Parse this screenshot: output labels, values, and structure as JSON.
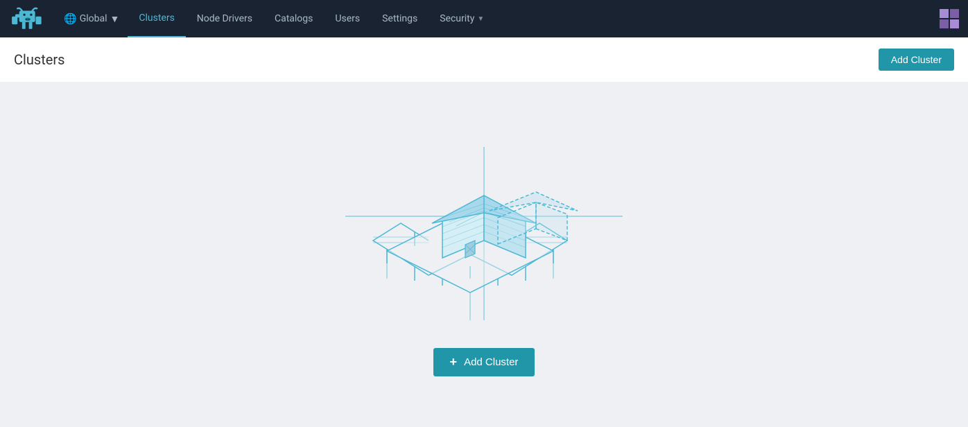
{
  "navbar": {
    "global_label": "Global",
    "nav_items": [
      {
        "id": "clusters",
        "label": "Clusters",
        "active": true,
        "has_dropdown": false
      },
      {
        "id": "node-drivers",
        "label": "Node Drivers",
        "active": false,
        "has_dropdown": false
      },
      {
        "id": "catalogs",
        "label": "Catalogs",
        "active": false,
        "has_dropdown": false
      },
      {
        "id": "users",
        "label": "Users",
        "active": false,
        "has_dropdown": false
      },
      {
        "id": "settings",
        "label": "Settings",
        "active": false,
        "has_dropdown": false
      },
      {
        "id": "security",
        "label": "Security",
        "active": false,
        "has_dropdown": true
      }
    ]
  },
  "page": {
    "title": "Clusters",
    "add_cluster_button": "Add Cluster",
    "add_cluster_center_button": "Add Cluster"
  }
}
